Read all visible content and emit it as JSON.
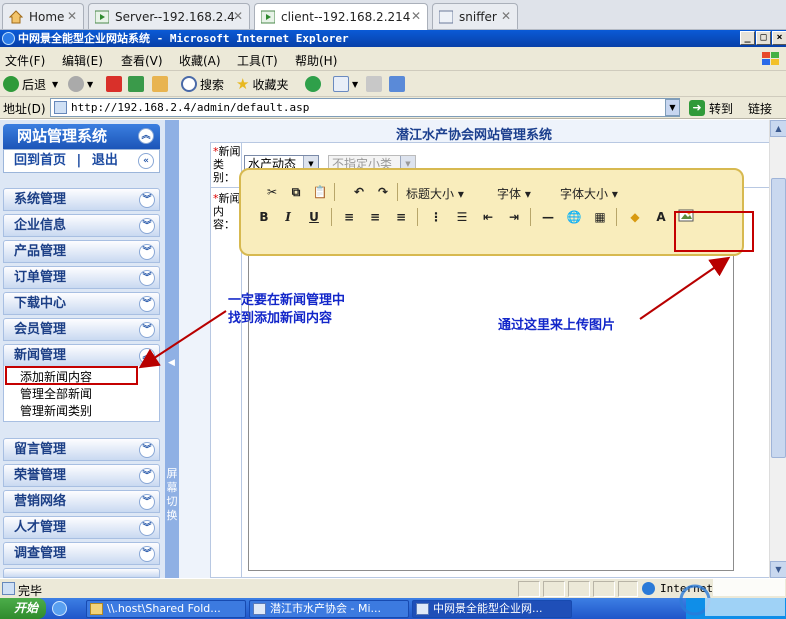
{
  "host_tabs": [
    {
      "label": "Home"
    },
    {
      "label": "Server--192.168.2.4"
    },
    {
      "label": "client--192.168.2.214"
    },
    {
      "label": "sniffer"
    }
  ],
  "window": {
    "title": "中网景全能型企业网站系统 - Microsoft Internet Explorer"
  },
  "menu": [
    "文件(F)",
    "编辑(E)",
    "查看(V)",
    "收藏(A)",
    "工具(T)",
    "帮助(H)"
  ],
  "toolbar": {
    "back": "后退",
    "search": "搜索",
    "favorites": "收藏夹"
  },
  "address": {
    "label": "地址(D)",
    "url": "http://192.168.2.4/admin/default.asp",
    "go": "转到",
    "links": "链接"
  },
  "sidebar": {
    "title": "网站管理系统",
    "home_link": "回到首页",
    "logout_link": "退出",
    "sections_top": [
      "系统管理",
      "企业信息",
      "产品管理",
      "订单管理",
      "下载中心",
      "会员管理"
    ],
    "news": {
      "title": "新闻管理",
      "items": [
        "添加新闻内容",
        "管理全部新闻",
        "管理新闻类别"
      ]
    },
    "sections_bottom": [
      "留言管理",
      "荣誉管理",
      "营销网络",
      "人才管理",
      "调查管理"
    ],
    "splitter_label": "屏幕切换"
  },
  "main": {
    "title": "潜江水产协会网站管理系统",
    "category_label": "新闻类别：",
    "category_value": "水产动态",
    "subcategory_value": "不指定小类",
    "content_label": "新闻内容："
  },
  "editor": {
    "dropdowns": [
      "标题大小",
      "字体",
      "字体大小"
    ]
  },
  "annotations": {
    "left": "一定要在新闻管理中\n找到添加新闻内容",
    "right": "通过这里来上传图片"
  },
  "status": {
    "text": "完毕",
    "zone": "Internet"
  },
  "taskbar": {
    "start": "开始",
    "tasks": [
      "\\\\.host\\Shared Fold...",
      "潜江市水产协会 - Mi...",
      "中网景全能型企业网..."
    ]
  },
  "colors": {
    "annotation_text": "#1226c9",
    "annotation_box": "#c40000",
    "nav_text": "#1c3f86"
  }
}
